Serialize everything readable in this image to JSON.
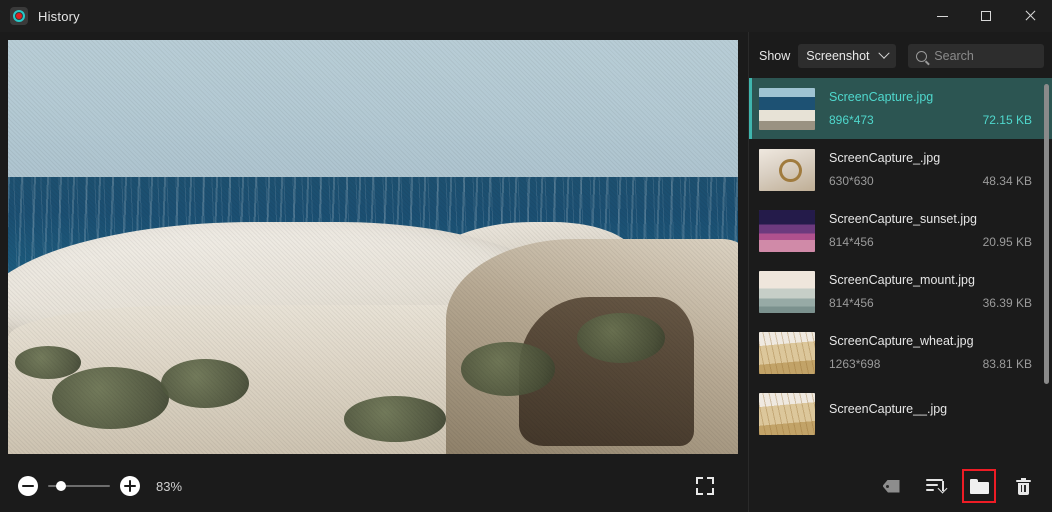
{
  "window": {
    "title": "History",
    "app_icon": "record-circle-icon",
    "controls": {
      "minimize": "minimize-icon",
      "maximize": "maximize-icon",
      "close": "close-icon"
    }
  },
  "viewer": {
    "image_alt": "Coastal cliff landscape with white rocks and turquoise lagoon",
    "zoom_out_label": "−",
    "zoom_in_label": "+",
    "zoom_percent": "83%",
    "fit_label": "fit-to-screen"
  },
  "sidebar": {
    "show_label": "Show",
    "filter_selected": "Screenshot",
    "search_placeholder": "Search",
    "search_value": "",
    "accent_color": "#4fd8cd",
    "selected_row_bg": "#2c5552",
    "items": [
      {
        "name": "ScreenCapture.jpg",
        "dimensions": "896*473",
        "size": "72.15 KB",
        "thumb": "t-sea",
        "selected": true
      },
      {
        "name": "ScreenCapture_.jpg",
        "dimensions": "630*630",
        "size": "48.34 KB",
        "thumb": "t-mir",
        "selected": false
      },
      {
        "name": "ScreenCapture_sunset.jpg",
        "dimensions": "814*456",
        "size": "20.95 KB",
        "thumb": "t-sun",
        "selected": false
      },
      {
        "name": "ScreenCapture_mount.jpg",
        "dimensions": "814*456",
        "size": "36.39 KB",
        "thumb": "t-mnt",
        "selected": false
      },
      {
        "name": "ScreenCapture_wheat.jpg",
        "dimensions": "1263*698",
        "size": "83.81 KB",
        "thumb": "t-wht",
        "selected": false
      },
      {
        "name": "ScreenCapture__.jpg",
        "dimensions": "",
        "size": "",
        "thumb": "t-wht",
        "selected": false
      }
    ]
  },
  "sidebar_toolbar": {
    "tag": "tag-icon",
    "sort": "sort-list-icon",
    "folder": "open-folder-icon",
    "delete": "trash-icon",
    "highlight_color": "#ee1c25"
  }
}
